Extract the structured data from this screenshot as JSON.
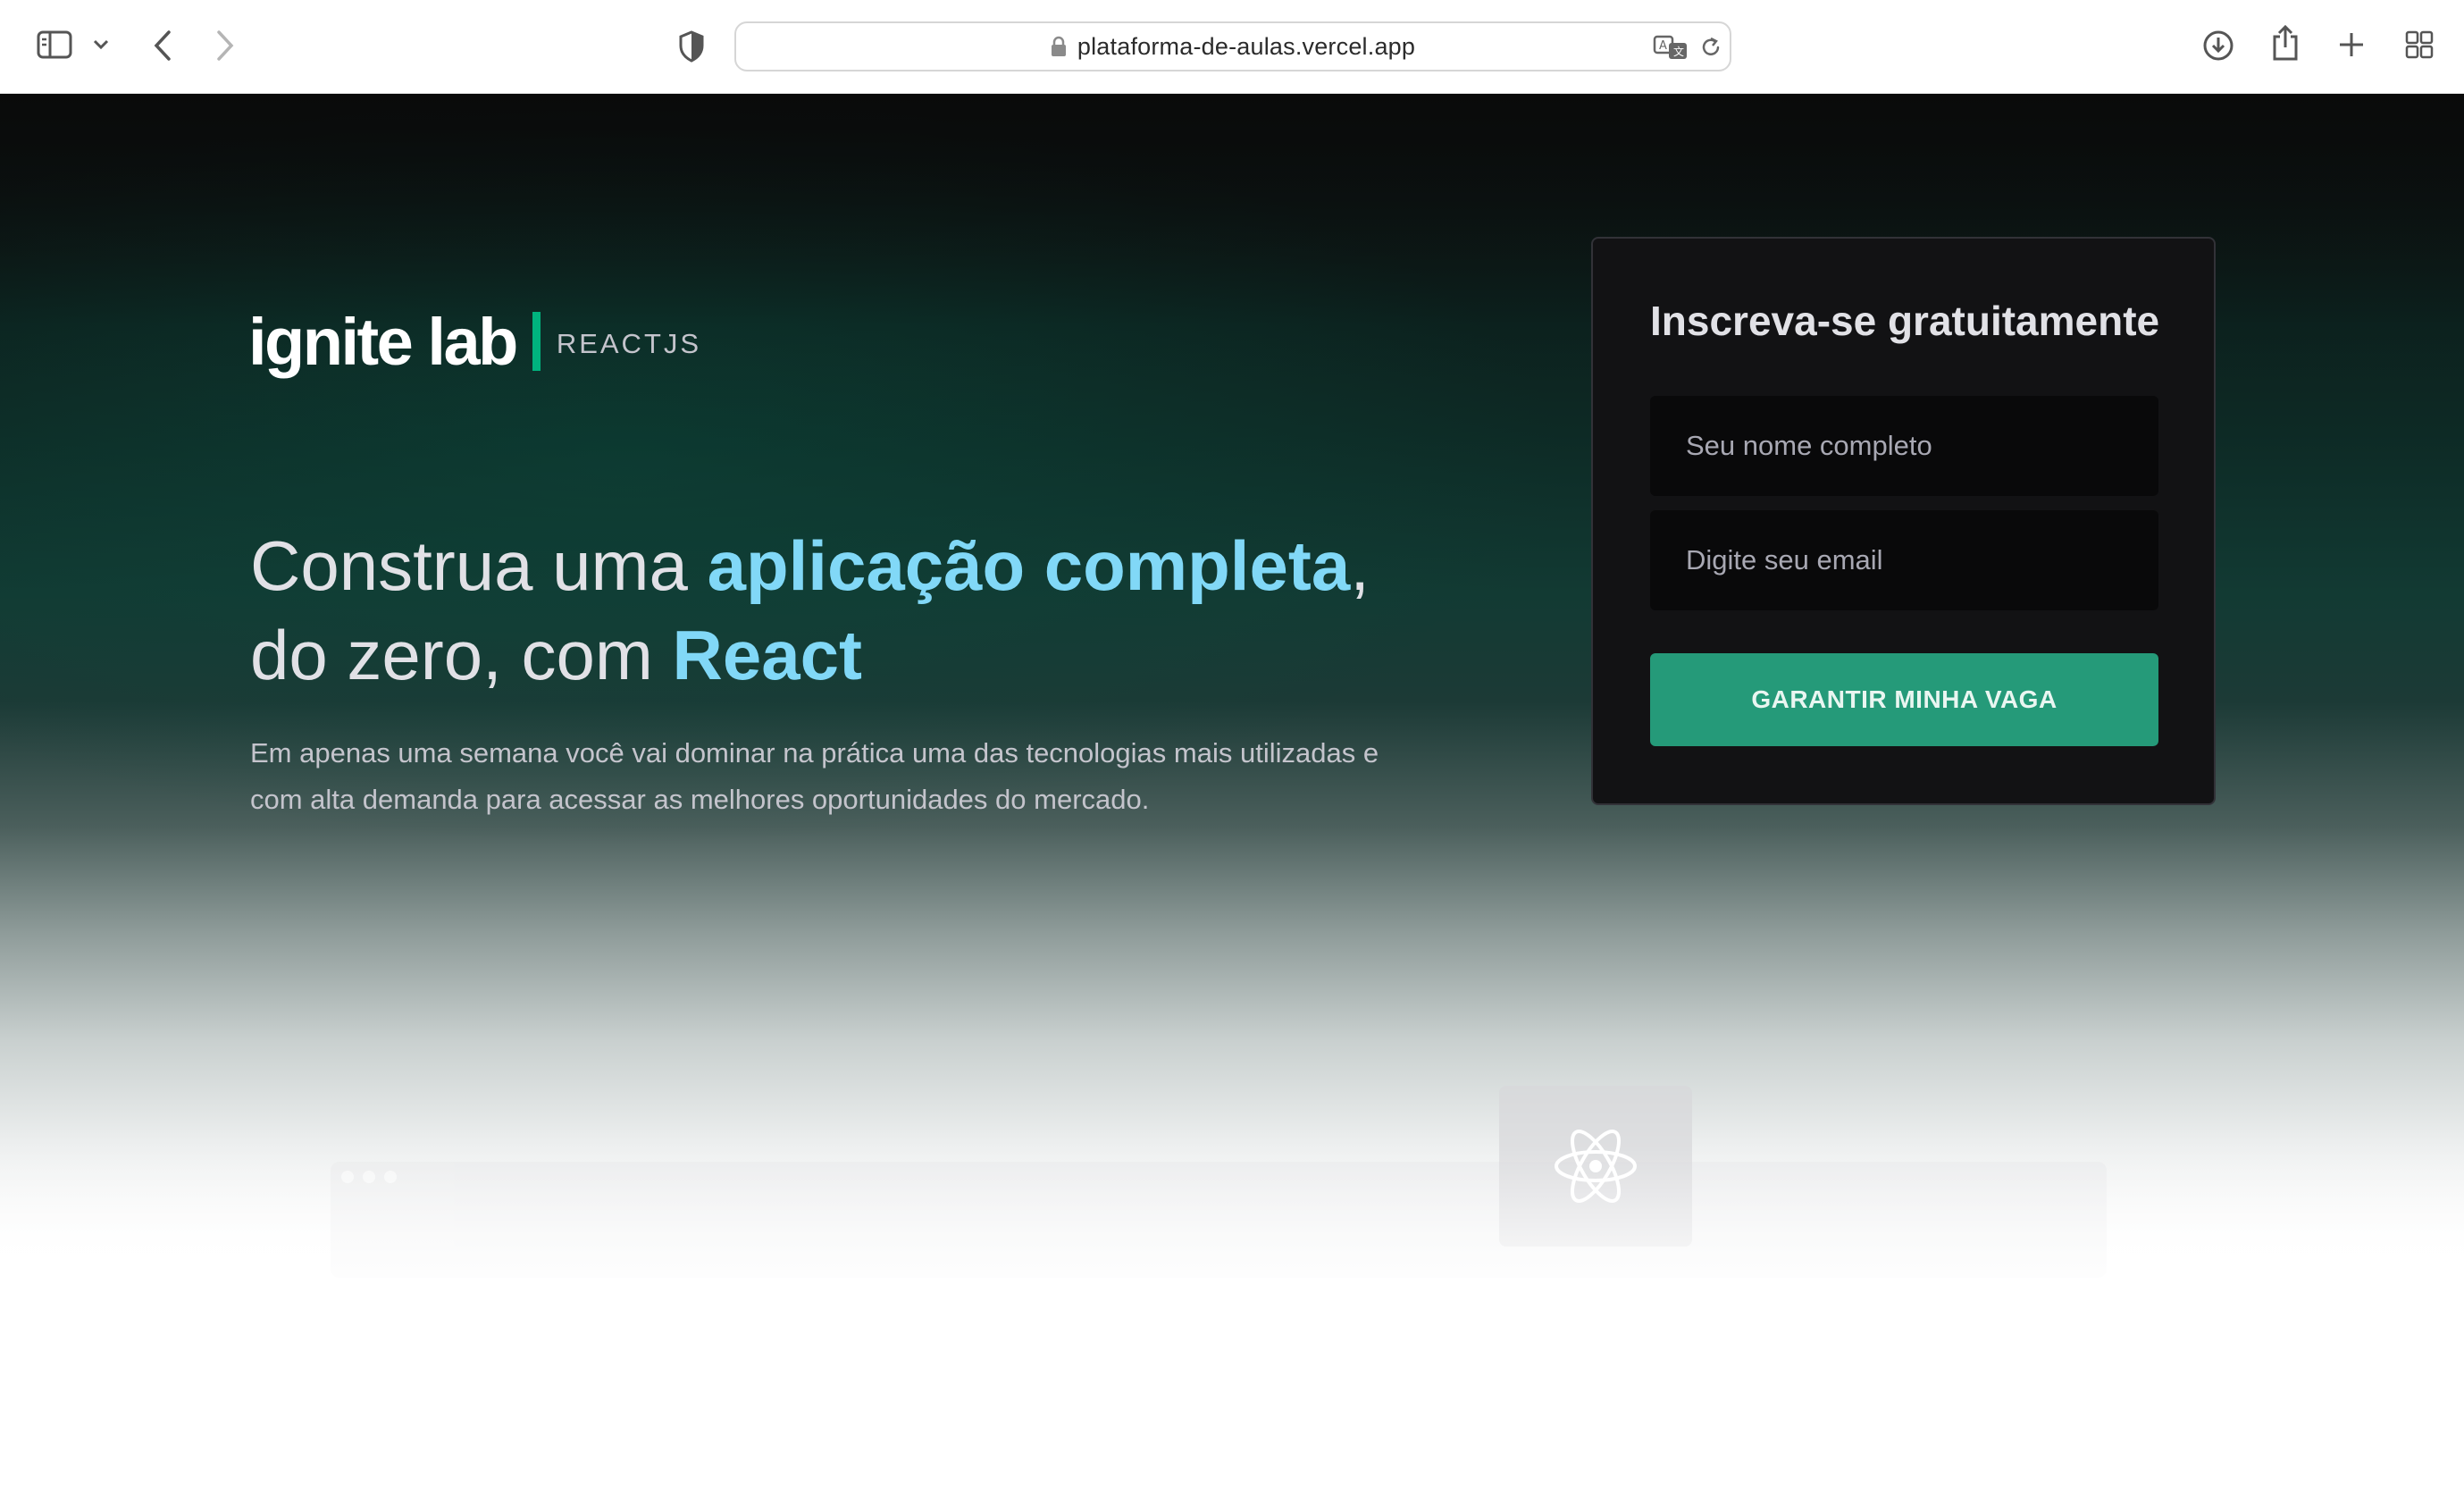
{
  "browser": {
    "url": "plataforma-de-aulas.vercel.app",
    "icons": {
      "sidebar": "sidebar-icon",
      "sidebar_menu": "chevron-down-icon",
      "back": "chevron-left-icon",
      "forward": "chevron-right-icon",
      "privacy": "shield-icon",
      "lock": "lock-icon",
      "translate": "translate-icon",
      "reload": "reload-icon",
      "downloads": "download-icon",
      "share": "share-icon",
      "new_tab": "plus-icon",
      "tab_overview": "grid-icon"
    }
  },
  "hero": {
    "logo_text": "ignite lab",
    "logo_sub": "REACTJS",
    "headline_part1": "Construa uma ",
    "headline_highlight1": "aplicação completa",
    "headline_part2": ",",
    "headline_part3": "do zero, com ",
    "headline_highlight2": "React",
    "description": "Em apenas uma semana você vai dominar na prática uma das tecnologias mais utilizadas e com alta demanda para acessar as melhores oportunidades do mercado."
  },
  "signup": {
    "title": "Inscreva-se gratuitamente",
    "name_placeholder": "Seu nome completo",
    "email_placeholder": "Digite seu email",
    "button_label": "GARANTIR MINHA VAGA"
  },
  "colors": {
    "accent_green": "#00b37e",
    "button_green": "#259a79",
    "highlight_blue": "#81d8f7",
    "card_bg": "#121214"
  },
  "mockup": {
    "icon": "react-logo-icon"
  }
}
